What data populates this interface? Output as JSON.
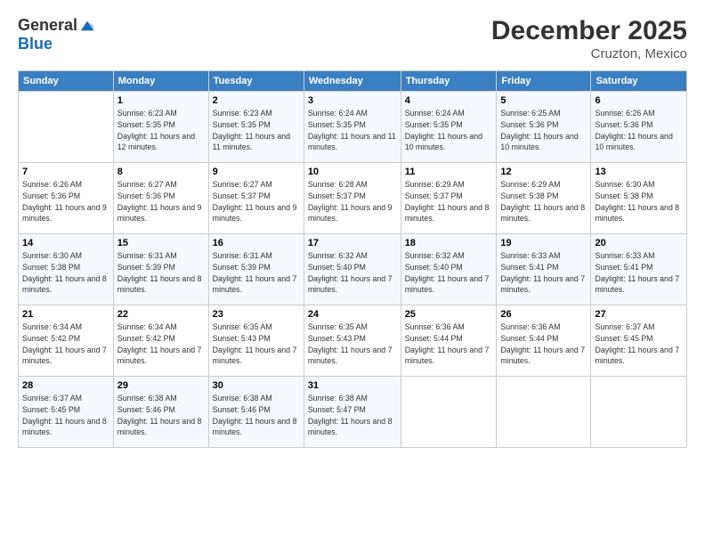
{
  "header": {
    "logo_line1": "General",
    "logo_line2": "Blue",
    "month": "December 2025",
    "location": "Cruzton, Mexico"
  },
  "days_of_week": [
    "Sunday",
    "Monday",
    "Tuesday",
    "Wednesday",
    "Thursday",
    "Friday",
    "Saturday"
  ],
  "weeks": [
    [
      {
        "day": "",
        "sunrise": "",
        "sunset": "",
        "daylight": ""
      },
      {
        "day": "1",
        "sunrise": "6:23 AM",
        "sunset": "5:35 PM",
        "daylight": "11 hours and 12 minutes."
      },
      {
        "day": "2",
        "sunrise": "6:23 AM",
        "sunset": "5:35 PM",
        "daylight": "11 hours and 11 minutes."
      },
      {
        "day": "3",
        "sunrise": "6:24 AM",
        "sunset": "5:35 PM",
        "daylight": "11 hours and 11 minutes."
      },
      {
        "day": "4",
        "sunrise": "6:24 AM",
        "sunset": "5:35 PM",
        "daylight": "11 hours and 10 minutes."
      },
      {
        "day": "5",
        "sunrise": "6:25 AM",
        "sunset": "5:36 PM",
        "daylight": "11 hours and 10 minutes."
      },
      {
        "day": "6",
        "sunrise": "6:26 AM",
        "sunset": "5:36 PM",
        "daylight": "11 hours and 10 minutes."
      }
    ],
    [
      {
        "day": "7",
        "sunrise": "6:26 AM",
        "sunset": "5:36 PM",
        "daylight": "11 hours and 9 minutes."
      },
      {
        "day": "8",
        "sunrise": "6:27 AM",
        "sunset": "5:36 PM",
        "daylight": "11 hours and 9 minutes."
      },
      {
        "day": "9",
        "sunrise": "6:27 AM",
        "sunset": "5:37 PM",
        "daylight": "11 hours and 9 minutes."
      },
      {
        "day": "10",
        "sunrise": "6:28 AM",
        "sunset": "5:37 PM",
        "daylight": "11 hours and 9 minutes."
      },
      {
        "day": "11",
        "sunrise": "6:29 AM",
        "sunset": "5:37 PM",
        "daylight": "11 hours and 8 minutes."
      },
      {
        "day": "12",
        "sunrise": "6:29 AM",
        "sunset": "5:38 PM",
        "daylight": "11 hours and 8 minutes."
      },
      {
        "day": "13",
        "sunrise": "6:30 AM",
        "sunset": "5:38 PM",
        "daylight": "11 hours and 8 minutes."
      }
    ],
    [
      {
        "day": "14",
        "sunrise": "6:30 AM",
        "sunset": "5:38 PM",
        "daylight": "11 hours and 8 minutes."
      },
      {
        "day": "15",
        "sunrise": "6:31 AM",
        "sunset": "5:39 PM",
        "daylight": "11 hours and 8 minutes."
      },
      {
        "day": "16",
        "sunrise": "6:31 AM",
        "sunset": "5:39 PM",
        "daylight": "11 hours and 7 minutes."
      },
      {
        "day": "17",
        "sunrise": "6:32 AM",
        "sunset": "5:40 PM",
        "daylight": "11 hours and 7 minutes."
      },
      {
        "day": "18",
        "sunrise": "6:32 AM",
        "sunset": "5:40 PM",
        "daylight": "11 hours and 7 minutes."
      },
      {
        "day": "19",
        "sunrise": "6:33 AM",
        "sunset": "5:41 PM",
        "daylight": "11 hours and 7 minutes."
      },
      {
        "day": "20",
        "sunrise": "6:33 AM",
        "sunset": "5:41 PM",
        "daylight": "11 hours and 7 minutes."
      }
    ],
    [
      {
        "day": "21",
        "sunrise": "6:34 AM",
        "sunset": "5:42 PM",
        "daylight": "11 hours and 7 minutes."
      },
      {
        "day": "22",
        "sunrise": "6:34 AM",
        "sunset": "5:42 PM",
        "daylight": "11 hours and 7 minutes."
      },
      {
        "day": "23",
        "sunrise": "6:35 AM",
        "sunset": "5:43 PM",
        "daylight": "11 hours and 7 minutes."
      },
      {
        "day": "24",
        "sunrise": "6:35 AM",
        "sunset": "5:43 PM",
        "daylight": "11 hours and 7 minutes."
      },
      {
        "day": "25",
        "sunrise": "6:36 AM",
        "sunset": "5:44 PM",
        "daylight": "11 hours and 7 minutes."
      },
      {
        "day": "26",
        "sunrise": "6:36 AM",
        "sunset": "5:44 PM",
        "daylight": "11 hours and 7 minutes."
      },
      {
        "day": "27",
        "sunrise": "6:37 AM",
        "sunset": "5:45 PM",
        "daylight": "11 hours and 7 minutes."
      }
    ],
    [
      {
        "day": "28",
        "sunrise": "6:37 AM",
        "sunset": "5:45 PM",
        "daylight": "11 hours and 8 minutes."
      },
      {
        "day": "29",
        "sunrise": "6:38 AM",
        "sunset": "5:46 PM",
        "daylight": "11 hours and 8 minutes."
      },
      {
        "day": "30",
        "sunrise": "6:38 AM",
        "sunset": "5:46 PM",
        "daylight": "11 hours and 8 minutes."
      },
      {
        "day": "31",
        "sunrise": "6:38 AM",
        "sunset": "5:47 PM",
        "daylight": "11 hours and 8 minutes."
      },
      {
        "day": "",
        "sunrise": "",
        "sunset": "",
        "daylight": ""
      },
      {
        "day": "",
        "sunrise": "",
        "sunset": "",
        "daylight": ""
      },
      {
        "day": "",
        "sunrise": "",
        "sunset": "",
        "daylight": ""
      }
    ]
  ],
  "labels": {
    "sunrise_prefix": "Sunrise: ",
    "sunset_prefix": "Sunset: ",
    "daylight_prefix": "Daylight: "
  }
}
